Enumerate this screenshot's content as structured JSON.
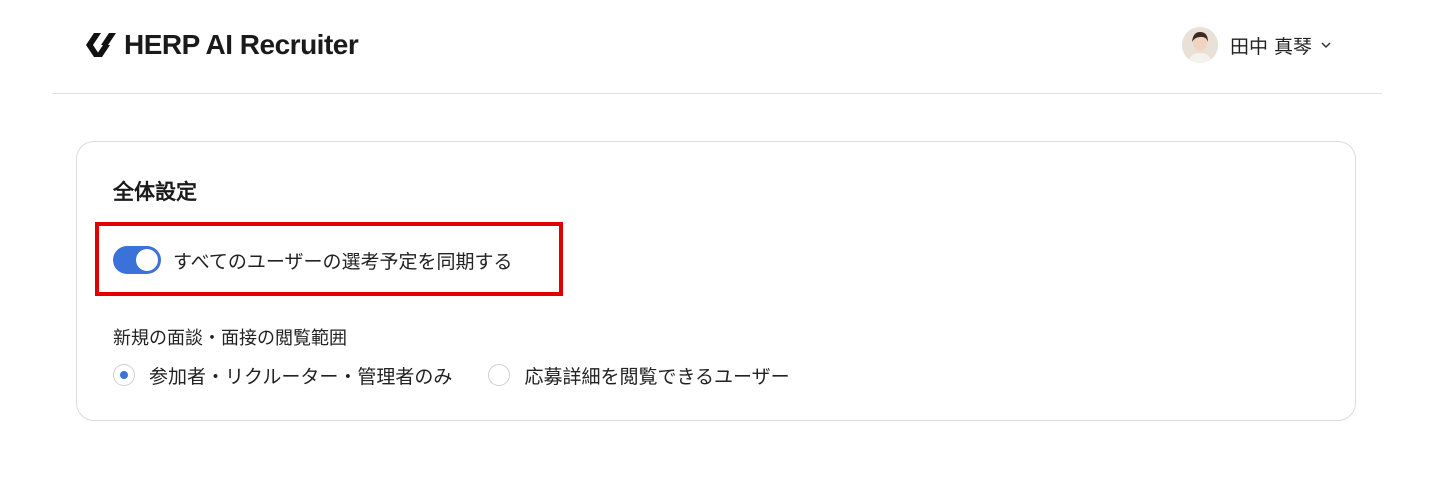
{
  "header": {
    "app_name": "HERP AI Recruiter",
    "user": {
      "name": "田中 真琴"
    }
  },
  "settings": {
    "title": "全体設定",
    "sync_toggle": {
      "label": "すべてのユーザーの選考予定を同期する",
      "on": true
    },
    "view_scope": {
      "label": "新規の面談・面接の閲覧範囲",
      "options": [
        {
          "label": "参加者・リクルーター・管理者のみ",
          "selected": true
        },
        {
          "label": "応募詳細を閲覧できるユーザー",
          "selected": false
        }
      ]
    }
  },
  "colors": {
    "accent": "#3b72d9",
    "highlight": "#e00000",
    "border": "#dcdcdc"
  }
}
